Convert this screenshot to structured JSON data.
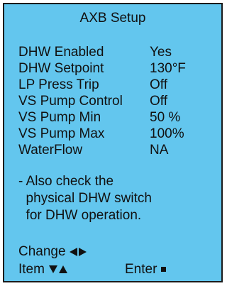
{
  "screen": {
    "title": "AXB Setup",
    "background_color": "#63c6ee",
    "settings": [
      {
        "label": "DHW Enabled",
        "value": "Yes"
      },
      {
        "label": "DHW Setpoint",
        "value": "130°F"
      },
      {
        "label": "LP Press Trip",
        "value": "Off"
      },
      {
        "label": "VS Pump Control",
        "value": "Off"
      },
      {
        "label": "VS Pump Min",
        "value": "50 %"
      },
      {
        "label": "VS Pump Max",
        "value": "100%"
      },
      {
        "label": "WaterFlow",
        "value": "NA"
      }
    ],
    "note": [
      "- Also check the",
      "  physical DHW switch",
      "  for DHW operation."
    ],
    "nav": {
      "change_label": "Change",
      "change_icons": [
        "left-arrow",
        "right-arrow"
      ],
      "item_label": "Item",
      "item_icons": [
        "down-arrow",
        "up-arrow"
      ],
      "enter_label": "Enter",
      "enter_icon": "square"
    }
  }
}
